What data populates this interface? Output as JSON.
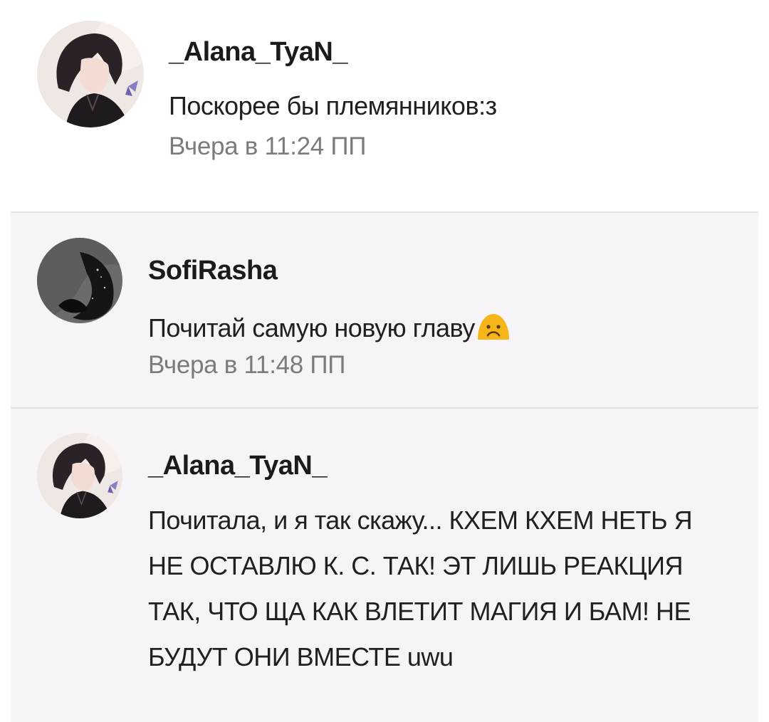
{
  "comments": [
    {
      "username": "_Alana_TyaN_",
      "text": "Поскорее бы племянников:з",
      "time": "Вчера в 11:24 ПП",
      "avatar_icon": "girl-avatar-icon"
    }
  ],
  "replies": [
    {
      "username": "SofiRasha",
      "text": "Почитай самую новую главу",
      "emoji": "sad-face-emoji",
      "time": "Вчера в 11:48 ПП",
      "avatar_icon": "dark-art-avatar-icon"
    },
    {
      "username": "_Alana_TyaN_",
      "text": "Почитала, и я так скажу... КХЕМ КХЕМ НЕТЬ Я НЕ ОСТАВЛЮ К. С. ТАК! ЭТ ЛИШЬ РЕАКЦИЯ ТАК, ЧТО ЩА КАК ВЛЕТИТ МАГИЯ И БАМ! НЕ БУДУТ ОНИ ВМЕСТЕ uwu",
      "avatar_icon": "girl-avatar-icon"
    }
  ],
  "colors": {
    "thread_background": "#f6f4f7",
    "timestamp": "#7b7a7f",
    "emoji_yellow": "#f6b619"
  }
}
